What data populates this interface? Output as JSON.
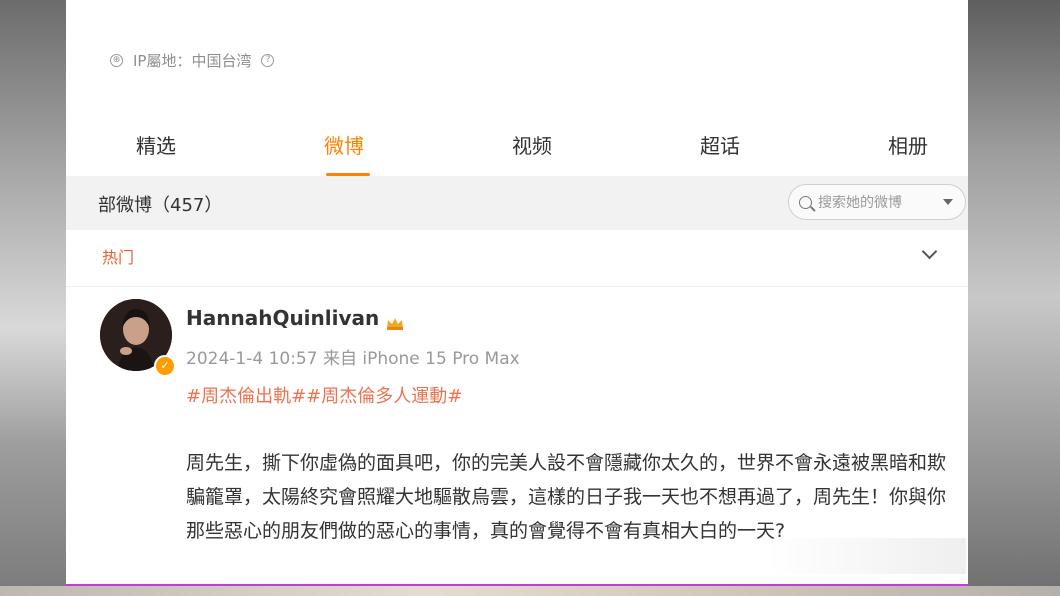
{
  "profile": {
    "ip_location": "IP屬地：中国台湾",
    "help_glyph": "?"
  },
  "tabs": [
    {
      "label": "精选"
    },
    {
      "label": "微博"
    },
    {
      "label": "视频"
    },
    {
      "label": "超话"
    },
    {
      "label": "相册"
    }
  ],
  "filter": {
    "all_weibo": "部微博（457）",
    "search_placeholder": "搜索她的微博",
    "hot_label": "热门"
  },
  "post": {
    "username": "HannahQuinlivan",
    "meta": "2024-1-4 10:57 来自 iPhone 15 Pro Max",
    "hashtags": "#周杰倫出軌##周杰倫多人運動#",
    "body": "周先生，撕下你虛偽的面具吧，你的完美人設不會隱藏你太久的，世界不會永遠被黑暗和欺騙籠罩，太陽終究會照耀大地驅散烏雲，這樣的日子我一天也不想再過了，周先生！你與你那些惡心的朋友們做的惡心的事情，真的會覺得不會有真相大白的一天?"
  },
  "colors": {
    "accent": "#ff8200",
    "hashtag": "#eb7350",
    "hot": "#e8632c"
  }
}
